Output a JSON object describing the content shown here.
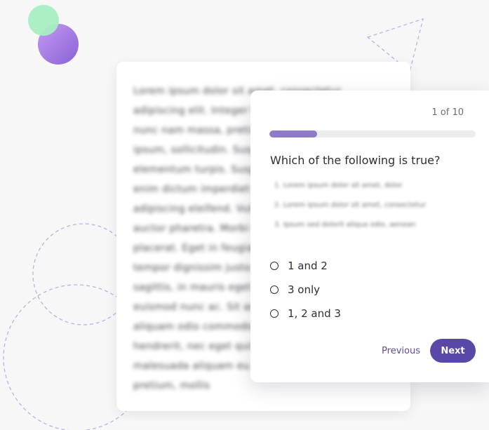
{
  "quiz": {
    "counter": "1 of 10",
    "progress": 0.23,
    "question": "Which of the following is true?",
    "statements": [
      "1. Lorem ipsum dolor sit amet, dolor",
      "2. Lorem ipsum dolor sit amet, consectetur",
      "3. Ipsum sed dolorit aliqua odio, aenean"
    ],
    "options": [
      {
        "label": "1 and 2"
      },
      {
        "label": "3 only"
      },
      {
        "label": "1, 2 and 3"
      }
    ],
    "previous_label": "Previous",
    "next_label": "Next"
  },
  "document": {
    "lines": [
      "Lorem ipsum dolor sit amet, consectetur",
      "adipiscing elit. Integer blandit magna",
      "nunc nam massa, pretium condimentum",
      "ipsum, sollicitudin. Suspendisse in",
      "elementum turpis. Suspendisse tortor",
      "enim dictum imperdiet sit. Aliquam ultrices",
      "adipiscing eleifend. Vulputate dui amet",
      "auctor pharetra. Morbi non tempor risus",
      "placerat. Eget in feugiat felis mattis",
      "tempor dignissim justo. Phasellus diam",
      "sagittis, in mauris eget facilisis.",
      "euismod nunc ac. Sit amet tellus orci",
      "aliquam odio commodo. Ullamcorper nisi",
      "hendrerit, nec eget quis vehicula.",
      "malesuada aliquam eu elementum ligula",
      "pretium, mollis"
    ]
  },
  "colors": {
    "accent": "#5a48a8",
    "progress_fill": "#8e7ac6",
    "bubble_purple": "#9b6fe0",
    "bubble_green": "#a8eec3",
    "deco_lines": "#b9b3e6"
  }
}
